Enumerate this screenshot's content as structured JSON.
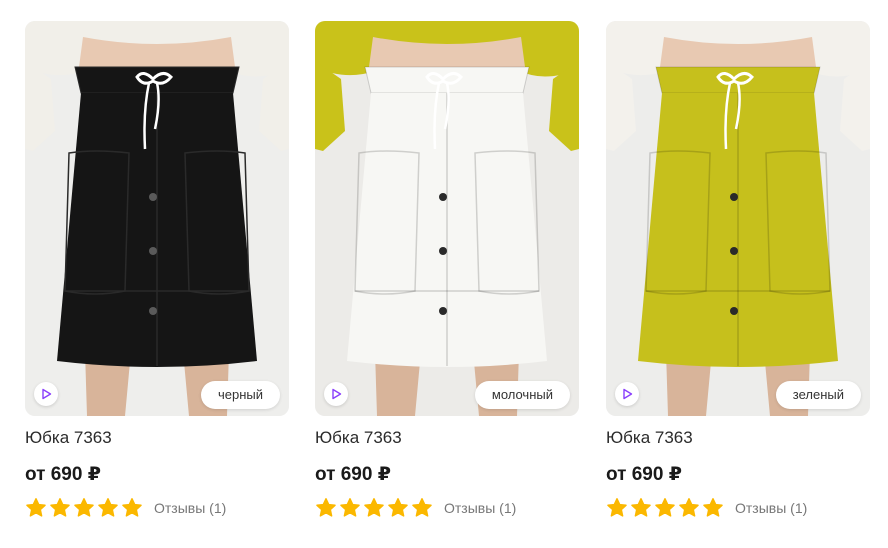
{
  "products": [
    {
      "title": "Юбка 7363",
      "price": "от 690 ₽",
      "color_label": "черный",
      "rating": 5,
      "reviews": "Отзывы (1)",
      "skirt_color": "#151515",
      "top_color": "#f1efe9",
      "bg_color": "#eeeeec",
      "cord_color": "#ffffff"
    },
    {
      "title": "Юбка 7363",
      "price": "от 690 ₽",
      "color_label": "молочный",
      "rating": 5,
      "reviews": "Отзывы (1)",
      "skirt_color": "#f7f7f4",
      "top_color": "#c9c21a",
      "bg_color": "#ecebe8",
      "cord_color": "#ffffff"
    },
    {
      "title": "Юбка 7363",
      "price": "от 690 ₽",
      "color_label": "зеленый",
      "rating": 5,
      "reviews": "Отзывы (1)",
      "skirt_color": "#c6c01c",
      "top_color": "#f3f1ec",
      "bg_color": "#ededeb",
      "cord_color": "#ffffff"
    }
  ],
  "colors": {
    "star": "#fbb800",
    "play_icon": "#8a3ffc"
  },
  "icons": {
    "play": "play-icon",
    "star": "star-icon"
  }
}
